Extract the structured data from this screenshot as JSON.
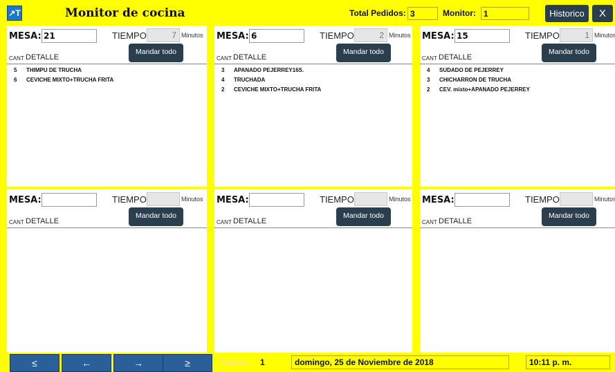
{
  "header": {
    "logo_text": "↗T",
    "title": "Monitor de cocina",
    "total_label": "Total Pedidos:",
    "total_value": "3",
    "monitor_label": "Monitor:",
    "monitor_value": "1",
    "historico_label": "Historico",
    "close_label": "X"
  },
  "labels": {
    "mesa": "MESA:",
    "tiempo": "TIEMPO",
    "minutos": "Minutos",
    "mandar": "Mandar todo",
    "cant": "CANT",
    "detalle": "DETALLE"
  },
  "panels": [
    {
      "mesa": "21",
      "tiempo": "7",
      "items": [
        {
          "qty": "5",
          "desc": "THIMPU DE TRUCHA"
        },
        {
          "qty": "6",
          "desc": "CEVICHE MIXTO+TRUCHA FRITA"
        }
      ]
    },
    {
      "mesa": "6",
      "tiempo": "2",
      "items": [
        {
          "qty": "3",
          "desc": "APANADO PEJERREY16S."
        },
        {
          "qty": "4",
          "desc": "TRUCHADA"
        },
        {
          "qty": "2",
          "desc": "CEVICHE MIXTO+TRUCHA FRITA"
        }
      ]
    },
    {
      "mesa": "15",
      "tiempo": "1",
      "items": [
        {
          "qty": "4",
          "desc": "SUDADO DE PEJERREY"
        },
        {
          "qty": "3",
          "desc": "CHICHARRON DE TRUCHA"
        },
        {
          "qty": "2",
          "desc": "CEV. mixto+APANADO PEJERREY"
        }
      ]
    },
    {
      "mesa": "",
      "tiempo": "",
      "items": []
    },
    {
      "mesa": "",
      "tiempo": "",
      "items": []
    },
    {
      "mesa": "",
      "tiempo": "",
      "items": []
    }
  ],
  "footer": {
    "first_label": "≤",
    "prev_label": "←",
    "next_label": "→",
    "last_label": "≥",
    "page_label": "Página:",
    "page_value": "1",
    "date": "domingo, 25 de Noviembre de 2018",
    "time": "10:11 p. m."
  }
}
